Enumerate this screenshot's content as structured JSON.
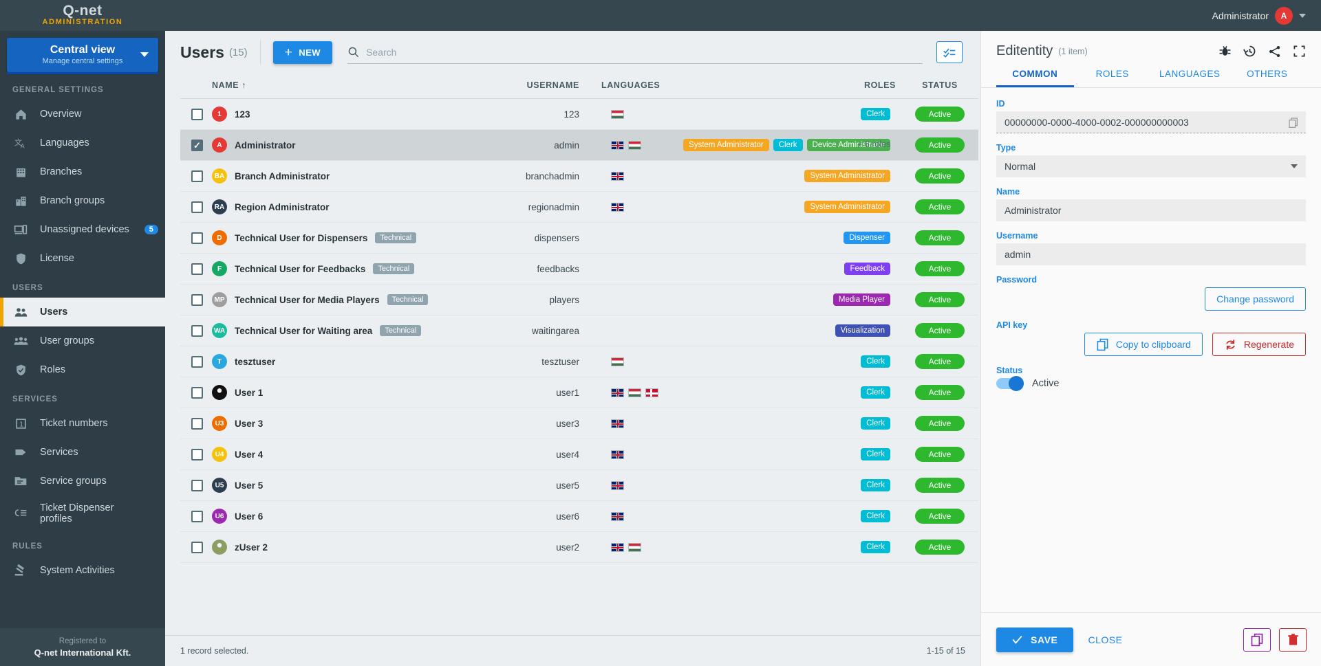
{
  "topbar": {
    "logo_text": "Q-net",
    "logo_sub": "ADMINISTRATION",
    "user_name": "Administrator",
    "user_initial": "A",
    "user_avatar_color": "#e53935"
  },
  "sidebar": {
    "view_button": {
      "title": "Central view",
      "subtitle": "Manage central settings"
    },
    "sections": [
      {
        "title": "GENERAL SETTINGS",
        "items": [
          {
            "label": "Overview",
            "icon": "home-icon",
            "active": false
          },
          {
            "label": "Languages",
            "icon": "translate-icon",
            "active": false
          },
          {
            "label": "Branches",
            "icon": "building-icon",
            "active": false
          },
          {
            "label": "Branch groups",
            "icon": "buildings-icon",
            "active": false
          },
          {
            "label": "Unassigned devices",
            "icon": "devices-icon",
            "active": false,
            "badge": "5"
          },
          {
            "label": "License",
            "icon": "shield-icon",
            "active": false
          }
        ]
      },
      {
        "title": "USERS",
        "items": [
          {
            "label": "Users",
            "icon": "users-icon",
            "active": true
          },
          {
            "label": "User groups",
            "icon": "user-group-icon",
            "active": false
          },
          {
            "label": "Roles",
            "icon": "shield-check-icon",
            "active": false
          }
        ]
      },
      {
        "title": "SERVICES",
        "items": [
          {
            "label": "Ticket numbers",
            "icon": "ticket-number-icon",
            "active": false
          },
          {
            "label": "Services",
            "icon": "tag-icon",
            "active": false
          },
          {
            "label": "Service groups",
            "icon": "folder-icon",
            "active": false
          },
          {
            "label": "Ticket Dispenser profiles",
            "icon": "dispenser-profile-icon",
            "active": false,
            "two_line": true
          }
        ]
      },
      {
        "title": "RULES",
        "items": [
          {
            "label": "System Activities",
            "icon": "gavel-icon",
            "active": false
          }
        ]
      }
    ],
    "footer": {
      "line1": "Registered to",
      "line2": "Q-net International Kft."
    }
  },
  "main": {
    "title": "Users",
    "count": "(15)",
    "new_button": "NEW",
    "search_placeholder": "Search",
    "search_value": "",
    "select_icon": "checklist-icon",
    "columns": [
      "NAME",
      "USERNAME",
      "LANGUAGES",
      "ROLES",
      "STATUS"
    ],
    "sort_indicator": "↑",
    "rows": [
      {
        "checked": false,
        "avatar": {
          "text": "1",
          "color": "#e53935"
        },
        "name": "123",
        "tag": "",
        "username": "123",
        "languages": [
          "hu"
        ],
        "roles": [
          {
            "label": "Clerk",
            "color": "#00bcd4"
          }
        ],
        "more_roles": "",
        "status": "Active"
      },
      {
        "checked": true,
        "avatar": {
          "text": "A",
          "color": "#e53935"
        },
        "name": "Administrator",
        "tag": "",
        "username": "admin",
        "languages": [
          "gb",
          "hu"
        ],
        "roles": [
          {
            "label": "System Administrator",
            "color": "#f5a623"
          },
          {
            "label": "Clerk",
            "color": "#00bcd4"
          },
          {
            "label": "Device Administrator",
            "color": "#4caf50"
          }
        ],
        "more_roles": "+ 6 roles",
        "status": "Active"
      },
      {
        "checked": false,
        "avatar": {
          "text": "BA",
          "color": "#f4c20d"
        },
        "name": "Branch Administrator",
        "tag": "",
        "username": "branchadmin",
        "languages": [
          "gb"
        ],
        "roles": [
          {
            "label": "System Administrator",
            "color": "#f5a623"
          }
        ],
        "more_roles": "",
        "status": "Active"
      },
      {
        "checked": false,
        "avatar": {
          "text": "RA",
          "color": "#2c3e50"
        },
        "name": "Region Administrator",
        "tag": "",
        "username": "regionadmin",
        "languages": [
          "gb"
        ],
        "roles": [
          {
            "label": "System Administrator",
            "color": "#f5a623"
          }
        ],
        "more_roles": "",
        "status": "Active"
      },
      {
        "checked": false,
        "avatar": {
          "text": "D",
          "color": "#ef6c00"
        },
        "name": "Technical User for Dispensers",
        "tag": "Technical",
        "username": "dispensers",
        "languages": [],
        "roles": [
          {
            "label": "Dispenser",
            "color": "#2196f3"
          }
        ],
        "more_roles": "",
        "status": "Active"
      },
      {
        "checked": false,
        "avatar": {
          "text": "F",
          "color": "#16a765"
        },
        "name": "Technical User for Feedbacks",
        "tag": "Technical",
        "username": "feedbacks",
        "languages": [],
        "roles": [
          {
            "label": "Feedback",
            "color": "#7e3ff2"
          }
        ],
        "more_roles": "",
        "status": "Active"
      },
      {
        "checked": false,
        "avatar": {
          "text": "MP",
          "color": "#9e9e9e"
        },
        "name": "Technical User for Media Players",
        "tag": "Technical",
        "username": "players",
        "languages": [],
        "roles": [
          {
            "label": "Media Player",
            "color": "#9c27b0"
          }
        ],
        "more_roles": "",
        "status": "Active"
      },
      {
        "checked": false,
        "avatar": {
          "text": "WA",
          "color": "#1abc9c"
        },
        "name": "Technical User for Waiting area",
        "tag": "Technical",
        "username": "waitingarea",
        "languages": [],
        "roles": [
          {
            "label": "Visualization",
            "color": "#3f51b5"
          }
        ],
        "more_roles": "",
        "status": "Active"
      },
      {
        "checked": false,
        "avatar": {
          "text": "T",
          "color": "#29a8e0"
        },
        "name": "tesztuser",
        "tag": "",
        "username": "tesztuser",
        "languages": [
          "hu"
        ],
        "roles": [
          {
            "label": "Clerk",
            "color": "#00bcd4"
          }
        ],
        "more_roles": "",
        "status": "Active"
      },
      {
        "checked": false,
        "avatar": {
          "text": "",
          "color": "#111111",
          "photo": "dog-photo"
        },
        "name": "User 1",
        "tag": "",
        "username": "user1",
        "languages": [
          "gb",
          "hu",
          "dk"
        ],
        "roles": [
          {
            "label": "Clerk",
            "color": "#00bcd4"
          }
        ],
        "more_roles": "",
        "status": "Active"
      },
      {
        "checked": false,
        "avatar": {
          "text": "U3",
          "color": "#ef6c00"
        },
        "name": "User 3",
        "tag": "",
        "username": "user3",
        "languages": [
          "gb"
        ],
        "roles": [
          {
            "label": "Clerk",
            "color": "#00bcd4"
          }
        ],
        "more_roles": "",
        "status": "Active"
      },
      {
        "checked": false,
        "avatar": {
          "text": "U4",
          "color": "#f4c20d"
        },
        "name": "User 4",
        "tag": "",
        "username": "user4",
        "languages": [
          "gb"
        ],
        "roles": [
          {
            "label": "Clerk",
            "color": "#00bcd4"
          }
        ],
        "more_roles": "",
        "status": "Active"
      },
      {
        "checked": false,
        "avatar": {
          "text": "U5",
          "color": "#2c3e50"
        },
        "name": "User 5",
        "tag": "",
        "username": "user5",
        "languages": [
          "gb"
        ],
        "roles": [
          {
            "label": "Clerk",
            "color": "#00bcd4"
          }
        ],
        "more_roles": "",
        "status": "Active"
      },
      {
        "checked": false,
        "avatar": {
          "text": "U6",
          "color": "#9c27b0"
        },
        "name": "User 6",
        "tag": "",
        "username": "user6",
        "languages": [
          "gb"
        ],
        "roles": [
          {
            "label": "Clerk",
            "color": "#00bcd4"
          }
        ],
        "more_roles": "",
        "status": "Active"
      },
      {
        "checked": false,
        "avatar": {
          "text": "",
          "color": "#8d9e63",
          "photo": "dog2-photo"
        },
        "name": "zUser 2",
        "tag": "",
        "username": "user2",
        "languages": [
          "gb",
          "hu"
        ],
        "roles": [
          {
            "label": "Clerk",
            "color": "#00bcd4"
          }
        ],
        "more_roles": "",
        "status": "Active"
      }
    ],
    "footer": {
      "selection": "1 record selected.",
      "pagination": "1-15 of 15"
    }
  },
  "panel": {
    "title": "Editentity",
    "subtitle": "(1 item)",
    "icons": [
      "bug-icon",
      "history-icon",
      "share-icon",
      "fullscreen-icon"
    ],
    "tabs": [
      {
        "label": "COMMON",
        "active": true
      },
      {
        "label": "ROLES",
        "active": false
      },
      {
        "label": "LANGUAGES",
        "active": false
      },
      {
        "label": "OTHERS",
        "active": false
      }
    ],
    "fields": {
      "id_label": "ID",
      "id_value": "00000000-0000-4000-0002-000000000003",
      "type_label": "Type",
      "type_value": "Normal",
      "name_label": "Name",
      "name_value": "Administrator",
      "username_label": "Username",
      "username_value": "admin",
      "password_label": "Password",
      "change_password_button": "Change password",
      "apikey_label": "API key",
      "copy_clipboard_button": "Copy to clipboard",
      "regenerate_button": "Regenerate",
      "status_label": "Status",
      "status_toggle_label": "Active"
    },
    "footer": {
      "save_button": "SAVE",
      "close_button": "CLOSE",
      "duplicate_icon": "duplicate-icon",
      "delete_icon": "trash-icon"
    }
  }
}
